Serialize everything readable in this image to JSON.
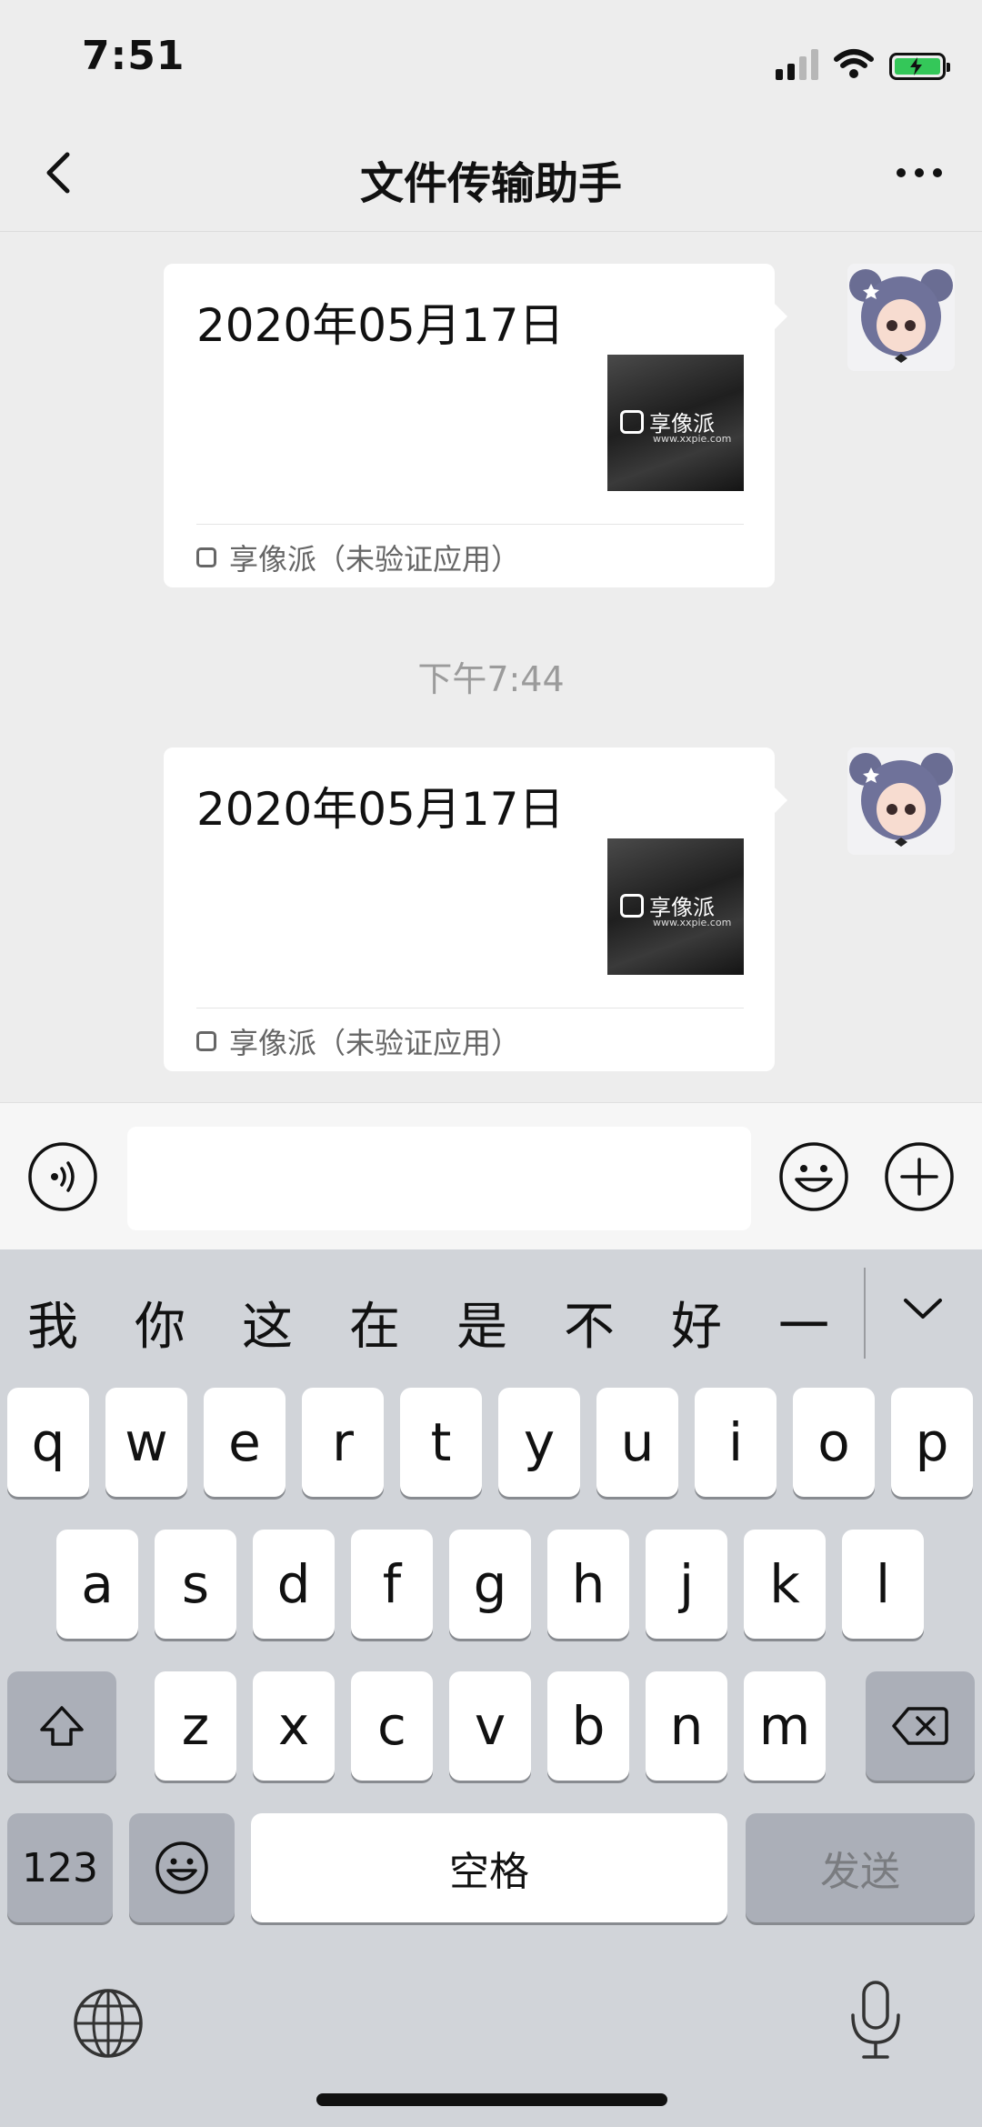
{
  "status_bar": {
    "time": "7:51"
  },
  "nav": {
    "title": "文件传输助手"
  },
  "messages": [
    {
      "title": "2020年05月17日",
      "thumb_brand": "享像派",
      "thumb_url": "www.xxpie.com",
      "source": "享像派（未验证应用）"
    },
    {
      "title": "2020年05月17日",
      "thumb_brand": "享像派",
      "thumb_url": "www.xxpie.com",
      "source": "享像派（未验证应用）"
    }
  ],
  "timestamp": "下午7:44",
  "input": {
    "placeholder": "",
    "value": ""
  },
  "keyboard": {
    "candidates": [
      "我",
      "你",
      "这",
      "在",
      "是",
      "不",
      "好",
      "一"
    ],
    "row1": [
      "q",
      "w",
      "e",
      "r",
      "t",
      "y",
      "u",
      "i",
      "o",
      "p"
    ],
    "row2": [
      "a",
      "s",
      "d",
      "f",
      "g",
      "h",
      "j",
      "k",
      "l"
    ],
    "row3": [
      "z",
      "x",
      "c",
      "v",
      "b",
      "n",
      "m"
    ],
    "num_label": "123",
    "space_label": "空格",
    "send_label": "发送"
  },
  "colors": {
    "battery": "#34c759",
    "keyboard_bg": "#d1d4d9",
    "chat_bg": "#ededed"
  }
}
